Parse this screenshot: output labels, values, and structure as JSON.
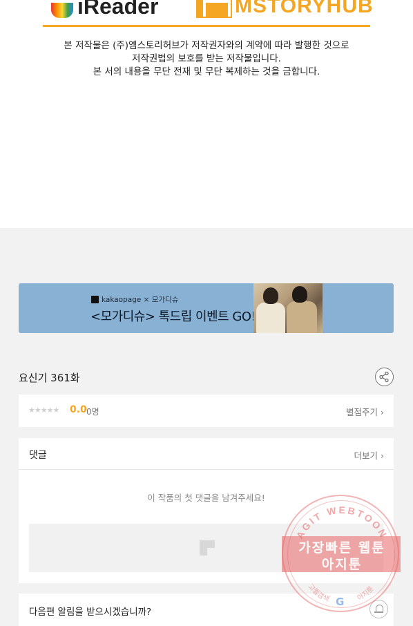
{
  "logos": {
    "left": "iReader",
    "right": "MSTORYHUB",
    "accent_color": "#f5a623"
  },
  "copyright": {
    "lines": [
      "본 저작물은 (주)엠스토리허브가 저작권자와의 계약에 따라 발행한 것으로",
      "저작권법의 보호를 받는 저작물입니다.",
      "본 서의 내용을 무단 전재 및 무단 복제하는 것을 금합니다."
    ]
  },
  "banner": {
    "brand": "kakaopage × 모가디슈",
    "title": "<모가디슈> 톡드립 이벤트 GO!",
    "bg_color": "#89b1d4"
  },
  "episode": {
    "title": "요신기 361화",
    "share_icon": "share-icon"
  },
  "rating": {
    "stars": "★★★★★",
    "score": "0.0",
    "count": "0명",
    "rate_link": "별점주기 ›"
  },
  "comments": {
    "title": "댓글",
    "more_link": "더보기 ›",
    "empty_message": "이 작품의 첫 댓글을 남겨주세요!"
  },
  "notify": {
    "text": "다음편 알림을 받으시겠습니까?",
    "bell_icon": "bell-icon"
  },
  "watermark": {
    "arc_text": "AGIT WEBTOON",
    "line1": "가장빠른 웹툰",
    "line2": "아지툰",
    "bottom_left": "고퀄검색",
    "bottom_right": "아지툰",
    "g": "G"
  }
}
